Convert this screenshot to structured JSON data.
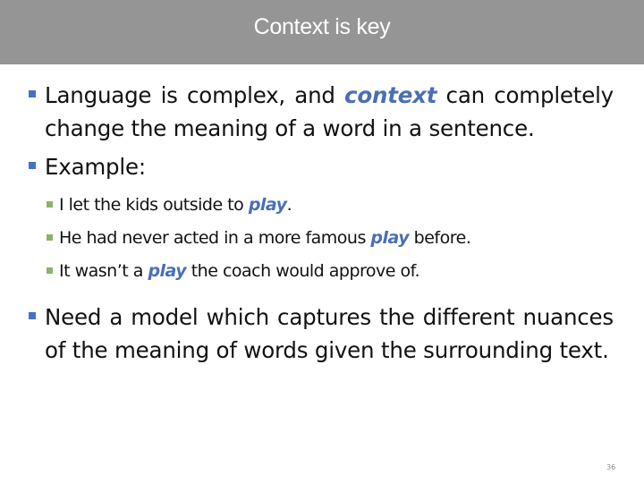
{
  "slide": {
    "title": "Context is key",
    "page_number": "36",
    "accent_color": "#4a6fb5",
    "bullet_color_level1": "#4472c4",
    "bullet_color_level2": "#8cb26a",
    "bullets": [
      {
        "pre": "Language is complex, and ",
        "highlight": "context",
        "post": " can completely change the meaning of a word in a sentence."
      },
      {
        "text": "Example:",
        "sub_bullets": [
          {
            "pre": "I let the kids outside to ",
            "highlight": "play",
            "post": "."
          },
          {
            "pre": "He had never acted in a more famous ",
            "highlight": "play",
            "post": " before."
          },
          {
            "pre": "It wasn’t a ",
            "highlight": "play",
            "post": " the coach would approve of."
          }
        ]
      },
      {
        "text": "Need a model which captures the different nuances of the meaning of words given the surrounding text."
      }
    ]
  }
}
